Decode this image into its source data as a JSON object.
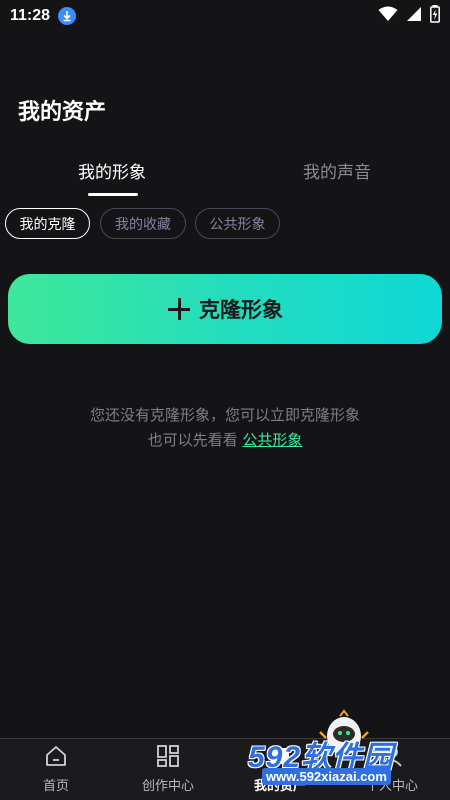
{
  "status_bar": {
    "time": "11:28",
    "icons": [
      "download-icon",
      "wifi-icon",
      "signal-icon",
      "battery-charging-icon"
    ]
  },
  "page": {
    "title": "我的资产"
  },
  "tabs": [
    {
      "label": "我的形象",
      "active": true
    },
    {
      "label": "我的声音",
      "active": false
    }
  ],
  "chips": [
    {
      "label": "我的克隆",
      "selected": true
    },
    {
      "label": "我的收藏",
      "selected": false
    },
    {
      "label": "公共形象",
      "selected": false
    }
  ],
  "clone_button": {
    "label": "克隆形象",
    "icon": "plus-icon"
  },
  "empty_state": {
    "line1": "您还没有克隆形象，您可以立即克隆形象",
    "line2_prefix": "也可以先看看 ",
    "line2_link": "公共形象"
  },
  "bottom_nav": [
    {
      "label": "首页",
      "icon": "home-icon"
    },
    {
      "label": "创作中心",
      "icon": "grid-icon"
    },
    {
      "label": "我的资产",
      "icon": "assets-icon",
      "active": true
    },
    {
      "label": "个人中心",
      "icon": "user-icon"
    }
  ],
  "watermark": {
    "brand": "592软件园",
    "url": "www.592xiazai.com"
  },
  "colors": {
    "background": "#141416",
    "accent_green": "#3ee89a",
    "accent_cyan": "#10d8d6",
    "muted_text": "#7e7e84"
  }
}
